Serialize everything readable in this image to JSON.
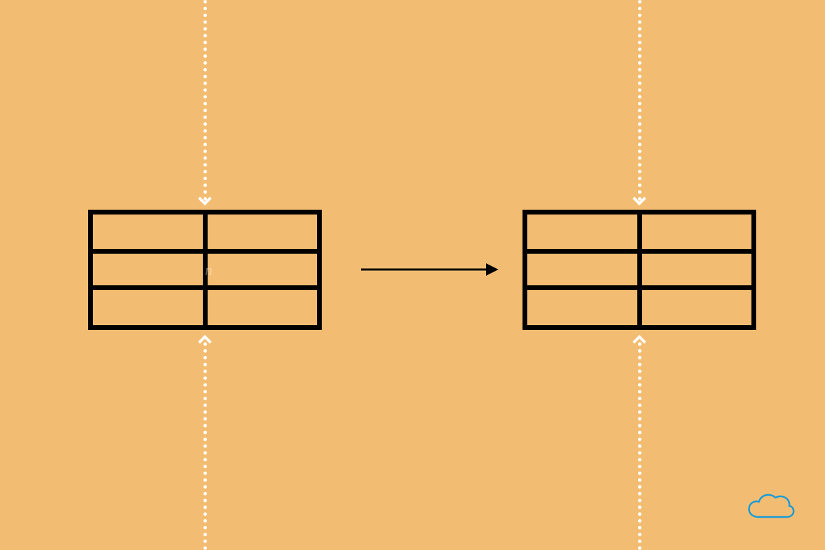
{
  "diagram": {
    "background": "#f2bd72",
    "left_table": {
      "rows": 3,
      "cols": 2
    },
    "right_table": {
      "rows": 3,
      "cols": 2
    },
    "arrow_direction": "right",
    "vertical_guides": {
      "left": {
        "top_arrow": "down",
        "bottom_arrow": "up"
      },
      "right": {
        "top_arrow": "down",
        "bottom_arrow": "up"
      }
    }
  },
  "watermark": {
    "glyph": "n"
  },
  "footer": {
    "icon": "cloud-icon"
  }
}
